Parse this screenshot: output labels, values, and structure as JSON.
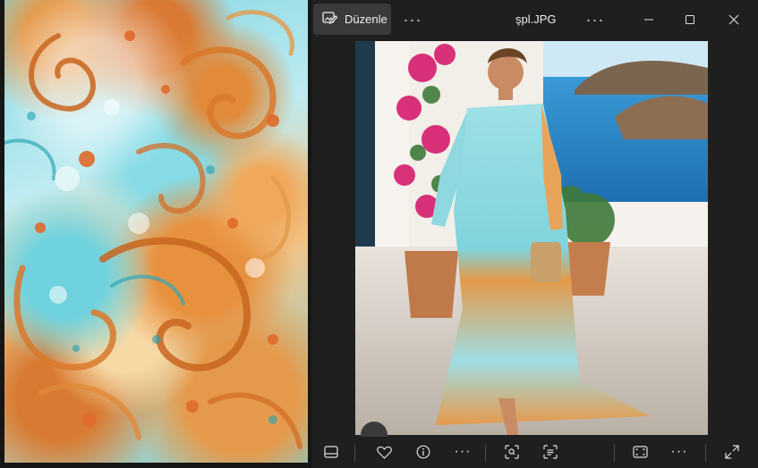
{
  "window": {
    "title": "şpl.JPG"
  },
  "toolbar": {
    "edit_label": "Düzenle",
    "more_glyph": "···"
  },
  "bottom_bar": {
    "more_glyph": "···"
  },
  "icons": {
    "edit": "edit-image-icon",
    "more": "more-options-icon",
    "minimize": "minimize-icon",
    "maximize": "maximize-icon",
    "close": "close-icon",
    "filmstrip": "filmstrip-icon",
    "favorite": "heart-icon",
    "info": "info-icon",
    "visual_search": "visual-search-icon",
    "text_scan": "text-scan-icon",
    "fit": "fit-to-window-icon",
    "fullscreen": "fullscreen-icon"
  },
  "colors": {
    "background": "#1f1f1f",
    "button": "#3a3a3a",
    "text": "#f0f0f0"
  }
}
